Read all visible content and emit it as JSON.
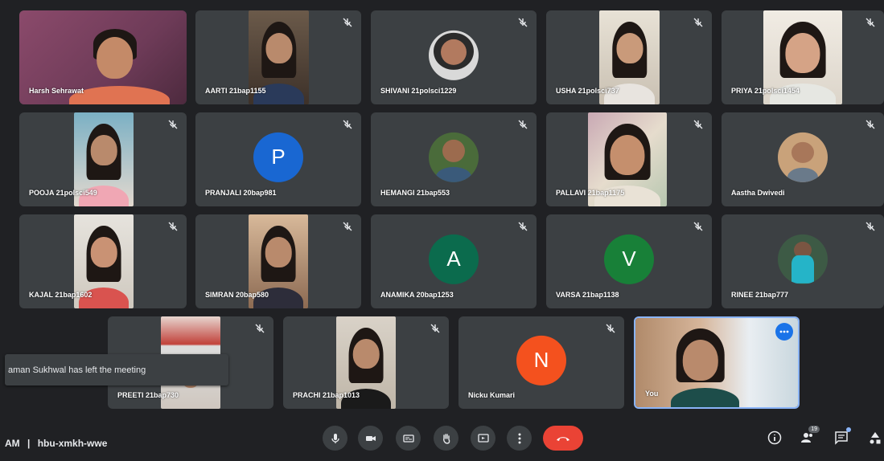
{
  "participants": [
    {
      "name": "Harsh Sehrawat",
      "muted": false,
      "video": "wide"
    },
    {
      "name": "AARTI 21bap1155",
      "muted": true,
      "video": "narrow"
    },
    {
      "name": "SHIVANI 21polsci1229",
      "muted": true,
      "video": "circle"
    },
    {
      "name": "USHA 21polsci737",
      "muted": true,
      "video": "narrow"
    },
    {
      "name": "PRIYA 21polsci1454",
      "muted": true,
      "video": "medium"
    },
    {
      "name": "POOJA 21polsci549",
      "muted": true,
      "video": "narrow"
    },
    {
      "name": "PRANJALI 20bap981",
      "muted": true,
      "avatar_letter": "P",
      "avatar_color": "#1967d2"
    },
    {
      "name": "HEMANGI 21bap553",
      "muted": true,
      "video": "circle"
    },
    {
      "name": "PALLAVI 21bap1175",
      "muted": true,
      "video": "medium"
    },
    {
      "name": "Aastha Dwivedi",
      "muted": true,
      "video": "circle"
    },
    {
      "name": "KAJAL 21bap1602",
      "muted": true,
      "video": "narrow"
    },
    {
      "name": "SIMRAN 20bap580",
      "muted": true,
      "video": "narrow"
    },
    {
      "name": "ANAMIKA 20bap1253",
      "muted": true,
      "avatar_letter": "A",
      "avatar_color": "#0b6b4d"
    },
    {
      "name": "VARSA 21bap1138",
      "muted": true,
      "avatar_letter": "V",
      "avatar_color": "#188038"
    },
    {
      "name": "RINEE 21bap777",
      "muted": true,
      "video": "circle"
    },
    {
      "name": "PREETI 21bap730",
      "muted": true,
      "video": "narrow"
    },
    {
      "name": "PRACHI 21bap1013",
      "muted": true,
      "video": "narrow"
    },
    {
      "name": "Nicku Kumari",
      "muted": true,
      "avatar_letter": "N",
      "avatar_color": "#f4511e"
    },
    {
      "name": "You",
      "muted": false,
      "video": "self"
    }
  ],
  "toast": "aman Sukhwal has left the meeting",
  "meeting_info": {
    "time": "AM",
    "separator": "|",
    "code": "hbu-xmkh-wwe"
  },
  "controls": {
    "mic": "mic-icon",
    "camera": "camera-icon",
    "captions": "captions-icon",
    "raise_hand": "hand-icon",
    "present": "present-icon",
    "more": "more-vert-icon",
    "leave": "end-call-icon"
  },
  "right_controls": {
    "participant_count": "19"
  },
  "colors": {
    "end_call": "#ea4335",
    "self_border": "#8ab4f8",
    "background": "#202124",
    "tile": "#3c4043"
  }
}
